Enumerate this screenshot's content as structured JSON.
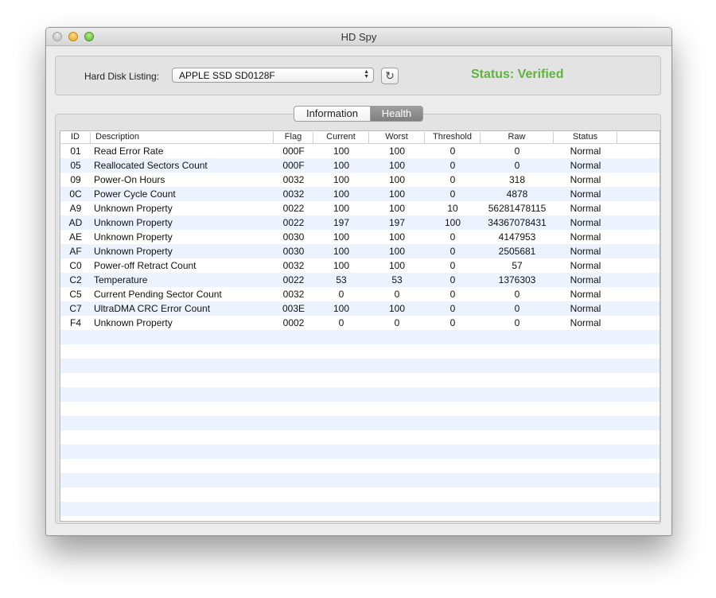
{
  "window": {
    "title": "HD Spy"
  },
  "top": {
    "disk_label": "Hard Disk Listing:",
    "disk_value": "APPLE SSD SD0128F",
    "refresh_icon": "refresh-icon",
    "status_text": "Status: Verified",
    "status_color": "#5fb43c"
  },
  "tabs": [
    {
      "label": "Information",
      "selected": false
    },
    {
      "label": "Health",
      "selected": true
    }
  ],
  "table": {
    "columns": [
      "ID",
      "Description",
      "Flag",
      "Current",
      "Worst",
      "Threshold",
      "Raw",
      "Status"
    ],
    "rows": [
      [
        "01",
        "Read Error Rate",
        "000F",
        "100",
        "100",
        "0",
        "0",
        "Normal"
      ],
      [
        "05",
        "Reallocated Sectors Count",
        "000F",
        "100",
        "100",
        "0",
        "0",
        "Normal"
      ],
      [
        "09",
        "Power-On Hours",
        "0032",
        "100",
        "100",
        "0",
        "318",
        "Normal"
      ],
      [
        "0C",
        "Power Cycle Count",
        "0032",
        "100",
        "100",
        "0",
        "4878",
        "Normal"
      ],
      [
        "A9",
        "Unknown Property",
        "0022",
        "100",
        "100",
        "10",
        "56281478115",
        "Normal"
      ],
      [
        "AD",
        "Unknown Property",
        "0022",
        "197",
        "197",
        "100",
        "34367078431",
        "Normal"
      ],
      [
        "AE",
        "Unknown Property",
        "0030",
        "100",
        "100",
        "0",
        "4147953",
        "Normal"
      ],
      [
        "AF",
        "Unknown Property",
        "0030",
        "100",
        "100",
        "0",
        "2505681",
        "Normal"
      ],
      [
        "C0",
        "Power-off Retract Count",
        "0032",
        "100",
        "100",
        "0",
        "57",
        "Normal"
      ],
      [
        "C2",
        "Temperature",
        "0022",
        "53",
        "53",
        "0",
        "1376303",
        "Normal"
      ],
      [
        "C5",
        "Current Pending Sector Count",
        "0032",
        "0",
        "0",
        "0",
        "0",
        "Normal"
      ],
      [
        "C7",
        "UltraDMA CRC Error Count",
        "003E",
        "100",
        "100",
        "0",
        "0",
        "Normal"
      ],
      [
        "F4",
        "Unknown Property",
        "0002",
        "0",
        "0",
        "0",
        "0",
        "Normal"
      ]
    ]
  }
}
